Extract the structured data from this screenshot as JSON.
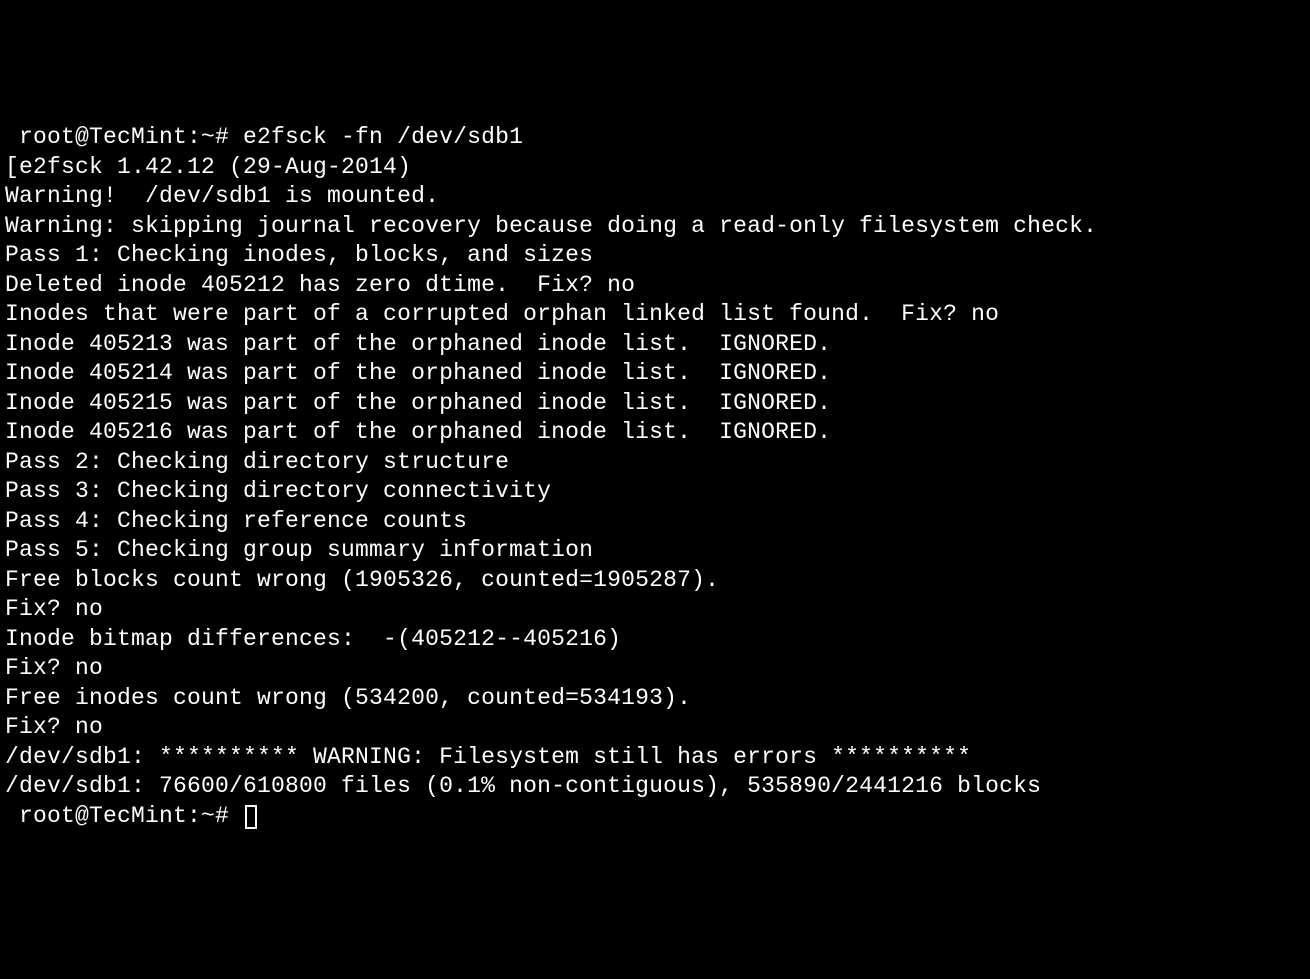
{
  "terminal": {
    "lines": [
      " root@TecMint:~# e2fsck -fn /dev/sdb1",
      "[e2fsck 1.42.12 (29-Aug-2014)",
      "Warning!  /dev/sdb1 is mounted.",
      "Warning: skipping journal recovery because doing a read-only filesystem check.",
      "Pass 1: Checking inodes, blocks, and sizes",
      "Deleted inode 405212 has zero dtime.  Fix? no",
      "",
      "Inodes that were part of a corrupted orphan linked list found.  Fix? no",
      "",
      "Inode 405213 was part of the orphaned inode list.  IGNORED.",
      "Inode 405214 was part of the orphaned inode list.  IGNORED.",
      "Inode 405215 was part of the orphaned inode list.  IGNORED.",
      "Inode 405216 was part of the orphaned inode list.  IGNORED.",
      "Pass 2: Checking directory structure",
      "Pass 3: Checking directory connectivity",
      "Pass 4: Checking reference counts",
      "Pass 5: Checking group summary information",
      "Free blocks count wrong (1905326, counted=1905287).",
      "Fix? no",
      "",
      "Inode bitmap differences:  -(405212--405216)",
      "Fix? no",
      "",
      "Free inodes count wrong (534200, counted=534193).",
      "Fix? no",
      "",
      "",
      "/dev/sdb1: ********** WARNING: Filesystem still has errors **********",
      "",
      "/dev/sdb1: 76600/610800 files (0.1% non-contiguous), 535890/2441216 blocks"
    ],
    "final_prompt": " root@TecMint:~# "
  }
}
